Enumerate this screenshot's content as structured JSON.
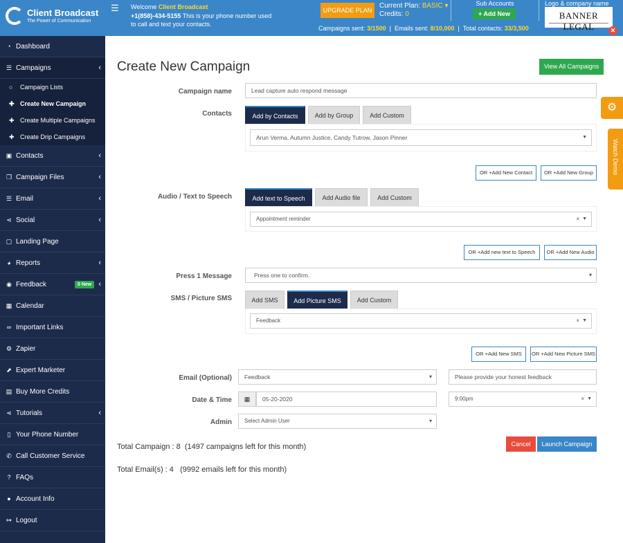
{
  "header": {
    "brand": "Client Broadcast",
    "tagline": "The Power of Communication",
    "welcome_prefix": "Welcome",
    "welcome_name": "Client Broadcast",
    "phone": "+1(858)-434-5155",
    "phone_note": "This is your phone number used to call and text your contacts.",
    "upgrade_label": "UPGRADE PLAN",
    "plan_label": "Current Plan:",
    "plan_value": "BASIC",
    "credits_label": "Credits:",
    "credits_value": "0",
    "sub_accounts_label": "Sub Accounts",
    "add_new_label": "Add New",
    "logo_label": "Logo & company name",
    "company_logo_text": "BANNER LEGAL",
    "campaigns_sent_label": "Campaigns sent:",
    "campaigns_sent_value": "3/1500",
    "emails_sent_label": "Emails sent:",
    "emails_sent_value": "8/10,000",
    "total_contacts_label": "Total contacts:",
    "total_contacts_value": "33/3,500"
  },
  "sidebar": {
    "items": [
      {
        "label": "Dashboard",
        "icon": "speedometer-icon"
      },
      {
        "label": "Campaigns",
        "icon": "list-icon"
      },
      {
        "label": "Contacts",
        "icon": "id-card-icon"
      },
      {
        "label": "Campaign Files",
        "icon": "files-icon"
      },
      {
        "label": "Email",
        "icon": "email-icon"
      },
      {
        "label": "Social",
        "icon": "share-icon"
      },
      {
        "label": "Landing Page",
        "icon": "page-icon"
      },
      {
        "label": "Reports",
        "icon": "gauge-icon"
      },
      {
        "label": "Feedback",
        "icon": "chat-icon",
        "badge": "0 New"
      },
      {
        "label": "Calendar",
        "icon": "calendar-icon"
      },
      {
        "label": "Important Links",
        "icon": "link-icon"
      },
      {
        "label": "Zapier",
        "icon": "gears-icon"
      },
      {
        "label": "Expert Marketer",
        "icon": "chart-icon"
      },
      {
        "label": "Buy More Credits",
        "icon": "money-icon"
      },
      {
        "label": "Tutorials",
        "icon": "share-icon"
      },
      {
        "label": "Your Phone Number",
        "icon": "mobile-icon"
      },
      {
        "label": "Call Customer Service",
        "icon": "phone-icon"
      },
      {
        "label": "FAQs",
        "icon": "question-icon"
      },
      {
        "label": "Account Info",
        "icon": "user-icon"
      },
      {
        "label": "Logout",
        "icon": "logout-icon"
      }
    ],
    "campaign_sub": [
      {
        "label": "Campaign Lists"
      },
      {
        "label": "Create New Campaign"
      },
      {
        "label": "Create Multiple Campaigns"
      },
      {
        "label": "Create Drip Campaigns"
      }
    ]
  },
  "main": {
    "title": "Create New Campaign",
    "view_all_label": "View All Campaigns",
    "campaign_name_label": "Campaign name",
    "campaign_name_value": "Lead capture auto respond message",
    "contacts_label": "Contacts",
    "contacts_tabs": [
      "Add by Contacts",
      "Add by Group",
      "Add Custom"
    ],
    "contacts_value": "Arun Verma, Autumn Justice, Candy Tutrow, Jason Pinner",
    "add_contact_label": "OR +Add New Contact",
    "add_group_label": "OR +Add New Group",
    "audio_label": "Audio / Text to Speech",
    "audio_tabs": [
      "Add text to Speech",
      "Add Audio file",
      "Add Custom"
    ],
    "audio_value": "Appointment reminder",
    "add_tts_label": "OR +Add new text to Speech",
    "add_audio_label": "OR +Add New Audio",
    "press1_label": "Press 1 Message",
    "press1_value": "Press one to confirm.",
    "sms_label": "SMS / Picture SMS",
    "sms_tabs": [
      "Add SMS",
      "Add Picture SMS",
      "Add Custom"
    ],
    "sms_value": "Feedback",
    "add_sms_label": "OR +Add New SMS",
    "add_picture_sms_label": "OR +Add New Picture SMS",
    "email_label": "Email (Optional)",
    "email_value": "Feedback",
    "email_note_placeholder": "Please provide your honest feedback",
    "date_label": "Date & Time",
    "date_value": "05-20-2020",
    "time_value": "9:00pm",
    "admin_label": "Admin",
    "admin_value": "Select Admin User",
    "total_campaign": "Total Campaign : 8",
    "campaigns_left": "(1497 campaigns left for this month)",
    "total_email": "Total Email(s) : 4",
    "emails_left": "(9992 emails left for this month)",
    "cancel_label": "Cancel",
    "launch_label": "Launch Campaign"
  },
  "float": {
    "watch_demo_label": "Watch Demo"
  }
}
